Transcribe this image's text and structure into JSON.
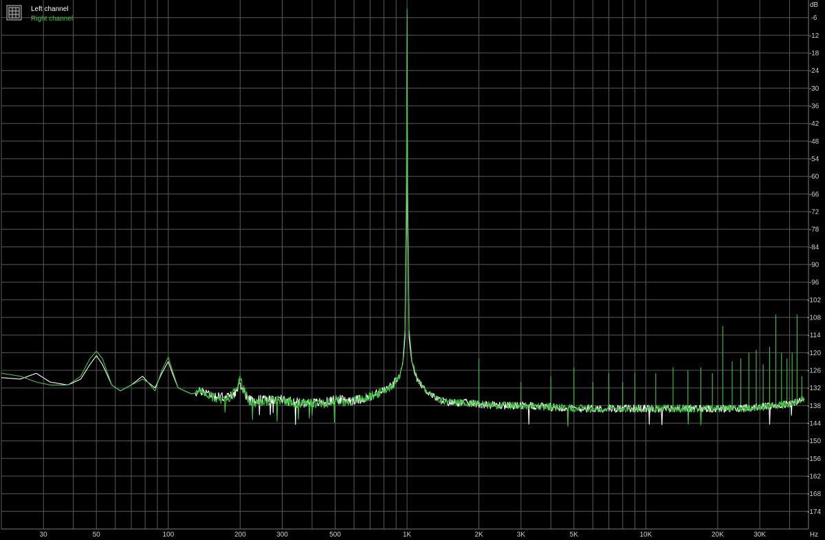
{
  "chart_data": {
    "type": "line",
    "xscale": "log",
    "xunit": "Hz",
    "yunit": "dB",
    "xlim": [
      20,
      48000
    ],
    "ylim": [
      -180,
      0
    ],
    "grid": true,
    "legend_position": "top-left",
    "x_ticks": [
      {
        "value": 30,
        "label": "30"
      },
      {
        "value": 50,
        "label": "50"
      },
      {
        "value": 100,
        "label": "100"
      },
      {
        "value": 200,
        "label": "200"
      },
      {
        "value": 300,
        "label": "300"
      },
      {
        "value": 500,
        "label": "500"
      },
      {
        "value": 1000,
        "label": "1K"
      },
      {
        "value": 2000,
        "label": "2K"
      },
      {
        "value": 3000,
        "label": "3K"
      },
      {
        "value": 5000,
        "label": "5K"
      },
      {
        "value": 10000,
        "label": "10K"
      },
      {
        "value": 20000,
        "label": "20K"
      },
      {
        "value": 30000,
        "label": "30K"
      }
    ],
    "y_ticks": [
      -6,
      -12,
      -18,
      -24,
      -30,
      -36,
      -42,
      -48,
      -54,
      -60,
      -66,
      -72,
      -78,
      -84,
      -90,
      -96,
      -102,
      -108,
      -114,
      -120,
      -126,
      -132,
      -138,
      -144,
      -150,
      -156,
      -162,
      -168,
      -174
    ],
    "x_minor_gridlines": [
      20,
      30,
      40,
      50,
      60,
      70,
      80,
      90,
      100,
      200,
      300,
      400,
      500,
      600,
      700,
      800,
      900,
      1000,
      2000,
      3000,
      4000,
      5000,
      6000,
      7000,
      8000,
      9000,
      10000,
      20000,
      30000,
      40000
    ],
    "series": [
      {
        "name": "Left channel",
        "color": "#ffffff",
        "points": [
          [
            20,
            -128.5
          ],
          [
            24,
            -129
          ],
          [
            28,
            -127
          ],
          [
            32,
            -130
          ],
          [
            38,
            -131
          ],
          [
            43,
            -129
          ],
          [
            47,
            -124
          ],
          [
            50,
            -121
          ],
          [
            53,
            -124
          ],
          [
            58,
            -131
          ],
          [
            63,
            -133
          ],
          [
            70,
            -131
          ],
          [
            78,
            -128
          ],
          [
            82,
            -130
          ],
          [
            88,
            -132
          ],
          [
            94,
            -127
          ],
          [
            100,
            -123
          ],
          [
            104,
            -127
          ],
          [
            110,
            -132
          ],
          [
            125,
            -134
          ],
          [
            140,
            -133
          ],
          [
            160,
            -135
          ],
          [
            180,
            -135
          ],
          [
            195,
            -133
          ],
          [
            200,
            -130
          ],
          [
            205,
            -133
          ],
          [
            220,
            -136
          ],
          [
            260,
            -136
          ],
          [
            300,
            -136
          ],
          [
            350,
            -137
          ],
          [
            400,
            -137
          ],
          [
            450,
            -137
          ],
          [
            500,
            -136
          ],
          [
            560,
            -136
          ],
          [
            620,
            -136
          ],
          [
            700,
            -135
          ],
          [
            800,
            -133
          ],
          [
            870,
            -131
          ],
          [
            930,
            -128
          ],
          [
            960,
            -124
          ],
          [
            980,
            -115
          ],
          [
            995,
            -70
          ],
          [
            1000,
            -5
          ],
          [
            1005,
            -70
          ],
          [
            1020,
            -115
          ],
          [
            1050,
            -124
          ],
          [
            1100,
            -129
          ],
          [
            1200,
            -133
          ],
          [
            1350,
            -136
          ],
          [
            1500,
            -137
          ],
          [
            1700,
            -137
          ],
          [
            2000,
            -137.5
          ],
          [
            2500,
            -138
          ],
          [
            3000,
            -138
          ],
          [
            4000,
            -138.5
          ],
          [
            5000,
            -139
          ],
          [
            7000,
            -139
          ],
          [
            10000,
            -139
          ],
          [
            15000,
            -139
          ],
          [
            20000,
            -139
          ],
          [
            25000,
            -139
          ],
          [
            30000,
            -138.5
          ],
          [
            35000,
            -138
          ],
          [
            40000,
            -137.5
          ],
          [
            44000,
            -136.5
          ],
          [
            46000,
            -136
          ]
        ]
      },
      {
        "name": "Right channel",
        "color": "#3cc83c",
        "points": [
          [
            20,
            -127
          ],
          [
            24,
            -128
          ],
          [
            28,
            -130
          ],
          [
            32,
            -131
          ],
          [
            38,
            -131
          ],
          [
            43,
            -128
          ],
          [
            47,
            -122
          ],
          [
            50,
            -119.5
          ],
          [
            53,
            -122
          ],
          [
            58,
            -131
          ],
          [
            63,
            -133
          ],
          [
            70,
            -131
          ],
          [
            78,
            -129
          ],
          [
            82,
            -130
          ],
          [
            88,
            -133
          ],
          [
            94,
            -126
          ],
          [
            100,
            -121.5
          ],
          [
            104,
            -126
          ],
          [
            110,
            -132
          ],
          [
            125,
            -134
          ],
          [
            140,
            -133
          ],
          [
            160,
            -136
          ],
          [
            180,
            -136
          ],
          [
            195,
            -132
          ],
          [
            200,
            -128
          ],
          [
            205,
            -132
          ],
          [
            220,
            -137
          ],
          [
            260,
            -136.5
          ],
          [
            300,
            -136
          ],
          [
            350,
            -137.5
          ],
          [
            400,
            -137
          ],
          [
            450,
            -137.5
          ],
          [
            500,
            -136
          ],
          [
            560,
            -137
          ],
          [
            620,
            -136
          ],
          [
            700,
            -135
          ],
          [
            800,
            -133
          ],
          [
            870,
            -131
          ],
          [
            930,
            -128
          ],
          [
            960,
            -123
          ],
          [
            980,
            -112
          ],
          [
            995,
            -60
          ],
          [
            1000,
            -3
          ],
          [
            1005,
            -60
          ],
          [
            1020,
            -112
          ],
          [
            1050,
            -123
          ],
          [
            1100,
            -129
          ],
          [
            1200,
            -133
          ],
          [
            1350,
            -136
          ],
          [
            1500,
            -137
          ],
          [
            1700,
            -137
          ],
          [
            2000,
            -137.5
          ],
          [
            2500,
            -138
          ],
          [
            3000,
            -138
          ],
          [
            4000,
            -138.5
          ],
          [
            5000,
            -139
          ],
          [
            7000,
            -139
          ],
          [
            10000,
            -139
          ],
          [
            15000,
            -139
          ],
          [
            20000,
            -139
          ],
          [
            25000,
            -139
          ],
          [
            30000,
            -138.5
          ],
          [
            35000,
            -138
          ],
          [
            40000,
            -137.5
          ],
          [
            44000,
            -136.5
          ],
          [
            46000,
            -136
          ]
        ]
      }
    ],
    "harmonic_spikes": [
      {
        "series": "Right channel",
        "freq": 2000,
        "peak": -122
      },
      {
        "series": "Right channel",
        "freq": 3000,
        "peak": -130
      },
      {
        "series": "Right channel",
        "freq": 4000,
        "peak": -128
      },
      {
        "series": "Right channel",
        "freq": 5000,
        "peak": -125
      },
      {
        "series": "Right channel",
        "freq": 6000,
        "peak": -130
      },
      {
        "series": "Right channel",
        "freq": 7000,
        "peak": -127
      },
      {
        "series": "Right channel",
        "freq": 8000,
        "peak": -130
      },
      {
        "series": "Right channel",
        "freq": 9000,
        "peak": -127
      },
      {
        "series": "Right channel",
        "freq": 11000,
        "peak": -127
      },
      {
        "series": "Right channel",
        "freq": 13000,
        "peak": -125
      },
      {
        "series": "Right channel",
        "freq": 15000,
        "peak": -126
      },
      {
        "series": "Right channel",
        "freq": 17000,
        "peak": -125
      },
      {
        "series": "Right channel",
        "freq": 19000,
        "peak": -127
      },
      {
        "series": "Right channel",
        "freq": 21000,
        "peak": -111
      },
      {
        "series": "Right channel",
        "freq": 23000,
        "peak": -123
      },
      {
        "series": "Right channel",
        "freq": 25000,
        "peak": -122
      },
      {
        "series": "Right channel",
        "freq": 27000,
        "peak": -120
      },
      {
        "series": "Right channel",
        "freq": 29000,
        "peak": -119
      },
      {
        "series": "Right channel",
        "freq": 31000,
        "peak": -124
      },
      {
        "series": "Right channel",
        "freq": 33000,
        "peak": -118
      },
      {
        "series": "Right channel",
        "freq": 35000,
        "peak": -107
      },
      {
        "series": "Right channel",
        "freq": 37000,
        "peak": -120
      },
      {
        "series": "Right channel",
        "freq": 39000,
        "peak": -122
      },
      {
        "series": "Right channel",
        "freq": 41000,
        "peak": -120
      },
      {
        "series": "Right channel",
        "freq": 43000,
        "peak": -107
      },
      {
        "series": "Right channel",
        "freq": 45000,
        "peak": -128
      }
    ]
  }
}
